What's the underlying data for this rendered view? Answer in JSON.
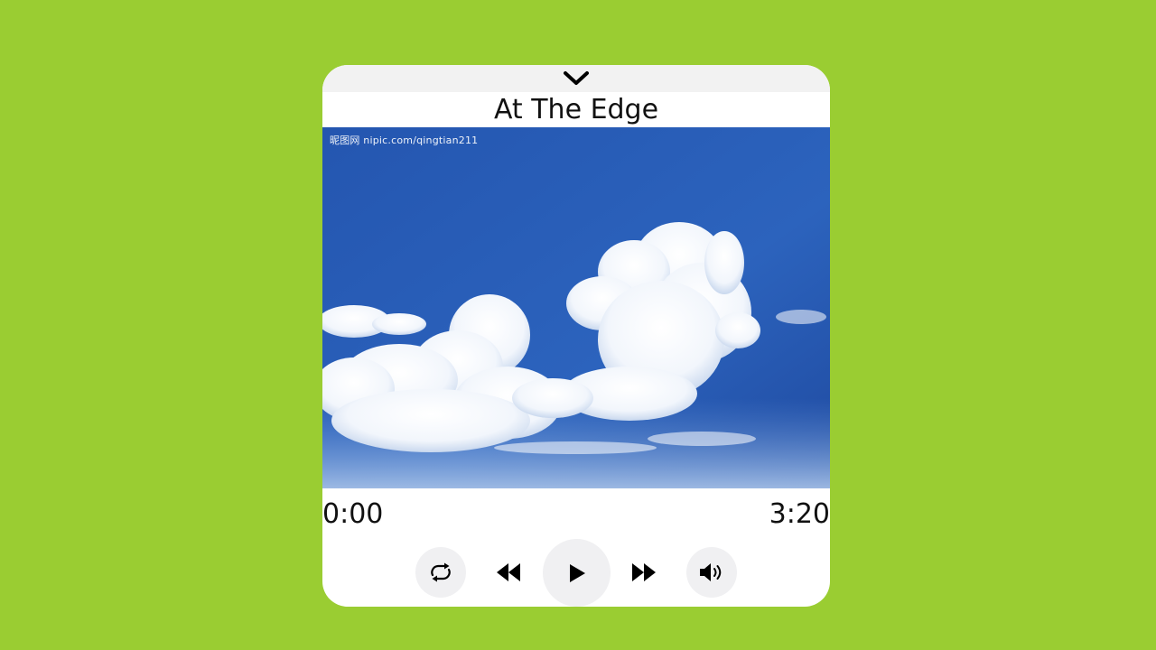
{
  "player": {
    "collapse_icon": "chevron-down-icon",
    "title": "At The Edge",
    "artwork": {
      "watermark": "昵图网 nipic.com/qingtian211"
    },
    "time": {
      "current": "0:00",
      "duration": "3:20"
    },
    "progress": 0,
    "controls": [
      {
        "name": "repeat",
        "icon": "repeat-icon"
      },
      {
        "name": "previous",
        "icon": "rewind-icon"
      },
      {
        "name": "play",
        "icon": "play-icon"
      },
      {
        "name": "next",
        "icon": "fast-forward-icon"
      },
      {
        "name": "volume",
        "icon": "volume-icon"
      }
    ]
  },
  "colors": {
    "background": "#9acd32",
    "card": "#ffffff",
    "header_bar": "#f2f2f2",
    "button_bg": "#f0f0f2",
    "sky": "#2a5fb8"
  }
}
